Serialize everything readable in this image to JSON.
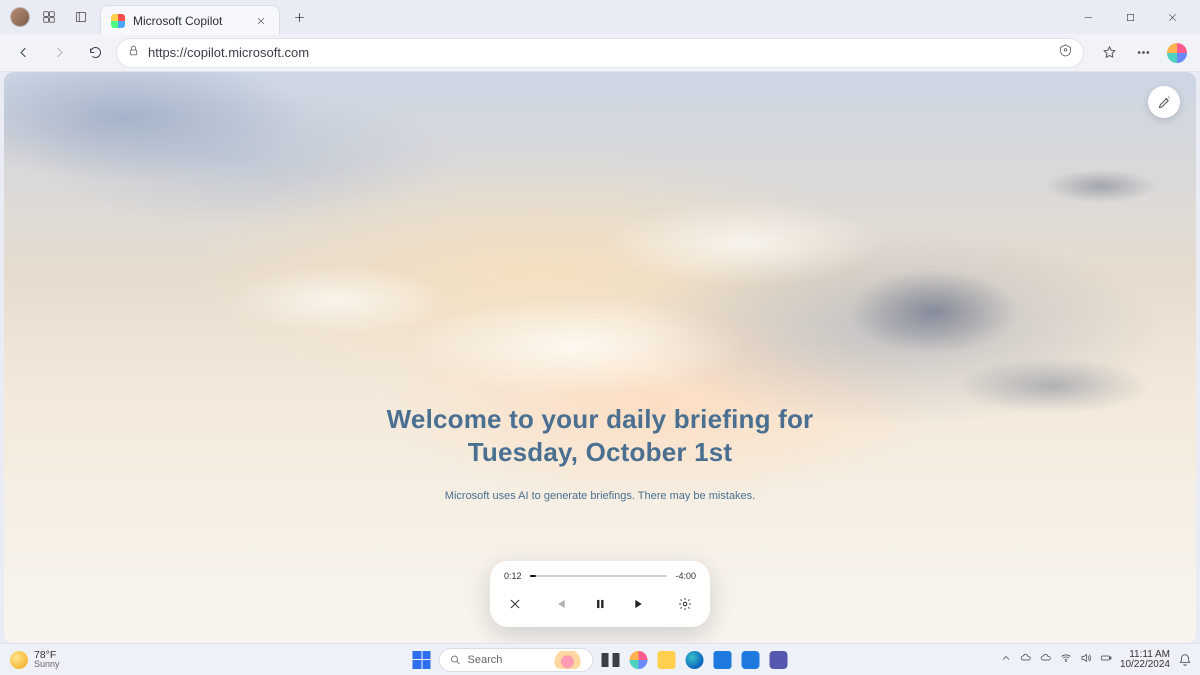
{
  "titlebar": {
    "tab_title": "Microsoft Copilot"
  },
  "toolbar": {
    "url": "https://copilot.microsoft.com"
  },
  "page": {
    "welcome_line1": "Welcome to your daily briefing for",
    "welcome_line2": "Tuesday, October 1st",
    "disclaimer": "Microsoft uses AI to generate briefings. There may be mistakes."
  },
  "player": {
    "elapsed": "0:12",
    "remaining": "-4:00",
    "progress_pct": 5
  },
  "taskbar": {
    "weather_temp": "78°F",
    "weather_cond": "Sunny",
    "search_placeholder": "Search",
    "time": "11:11 AM",
    "date": "10/22/2024"
  }
}
